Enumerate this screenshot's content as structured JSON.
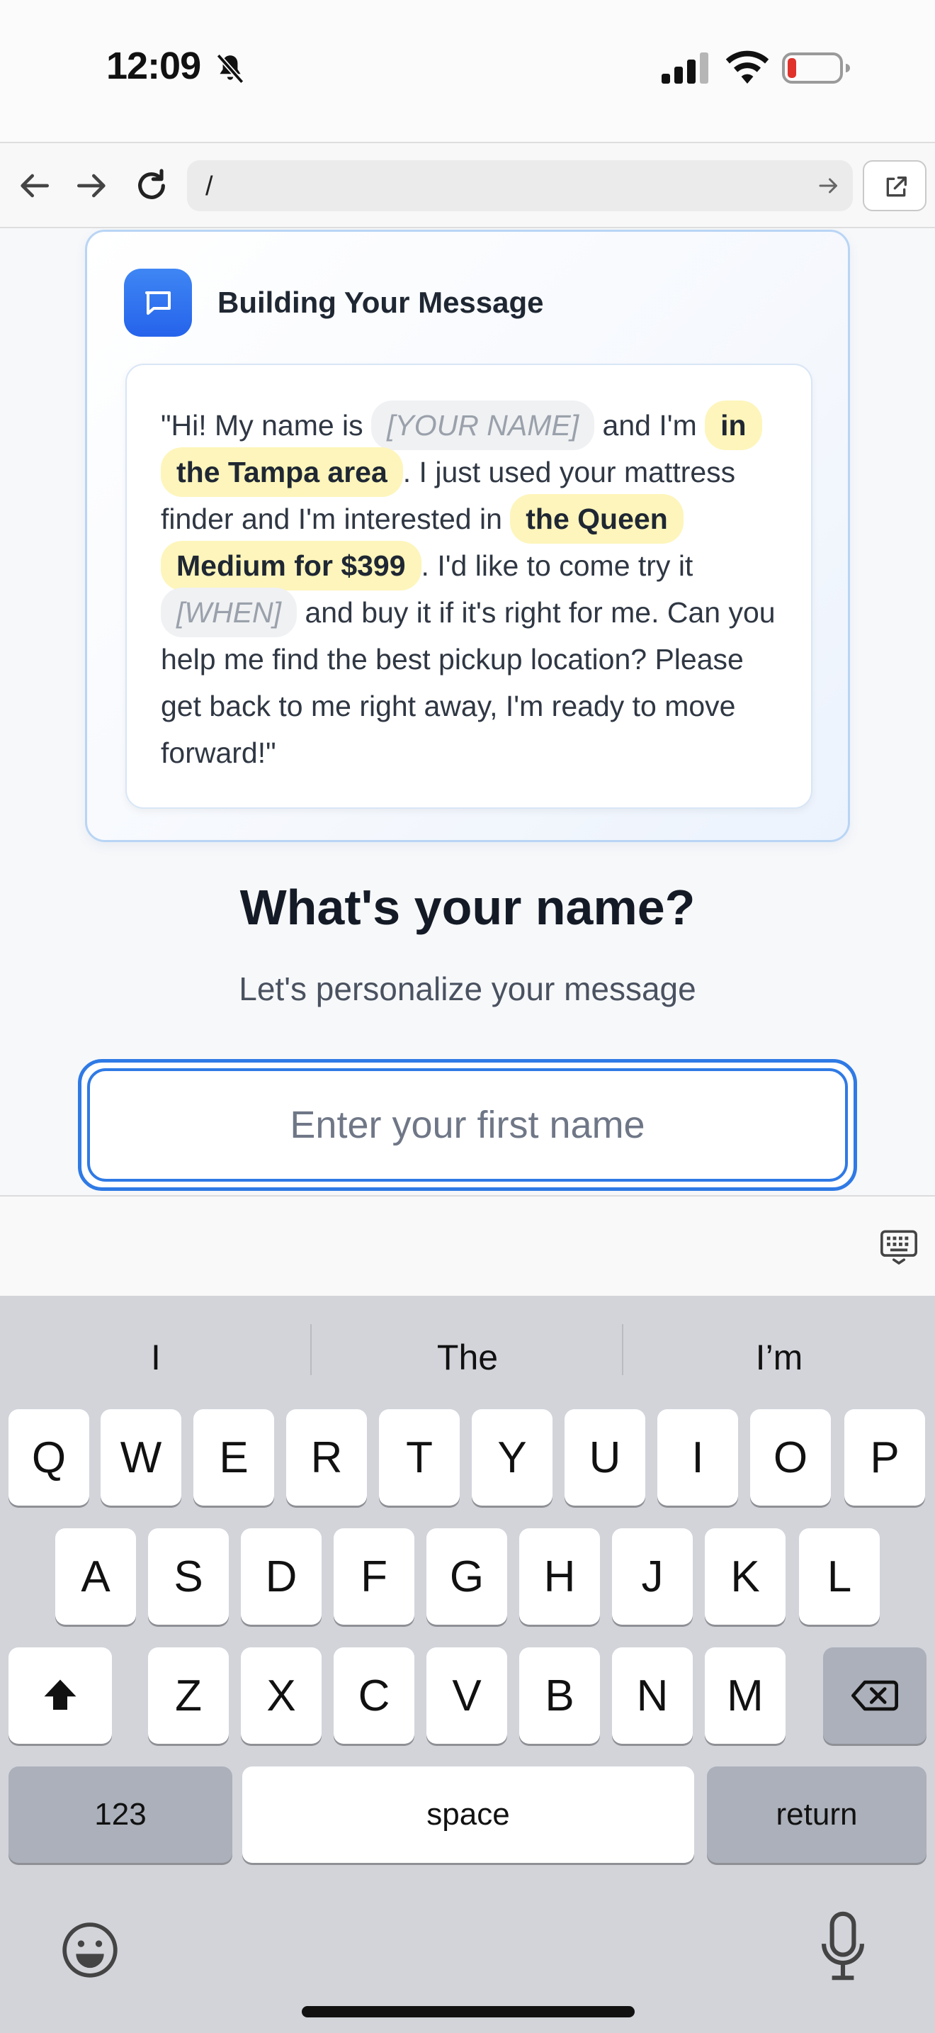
{
  "status_bar": {
    "time": "12:09",
    "icons": [
      "bell-slash-icon",
      "signal-icon",
      "wifi-icon",
      "battery-low-icon"
    ]
  },
  "browser": {
    "url": "/",
    "icons": [
      "back-arrow-icon",
      "forward-arrow-icon",
      "reload-icon",
      "go-arrow-icon",
      "open-external-icon"
    ]
  },
  "message_card": {
    "title": "Building Your Message",
    "icon": "chat-bubble-icon",
    "text": {
      "p1": "\"Hi! My name is ",
      "name_placeholder": "[YOUR NAME]",
      "p2": " and I'm ",
      "area": "in the Tampa area",
      "p3": ". I just used your mattress finder and I'm interested in ",
      "product": "the Queen Medium for $399",
      "p4": ". I'd like to come try it ",
      "when_placeholder": "[WHEN]",
      "p5": " and buy it if it's right for me. Can you help me find the best pickup location? Please get back to me right away, I'm ready to move forward!\""
    }
  },
  "question": {
    "title": "What's your name?",
    "subtitle": "Let's personalize your message",
    "input_placeholder": "Enter your first name"
  },
  "keyboard": {
    "suggestions": [
      "I",
      "The",
      "I’m"
    ],
    "row1": [
      "Q",
      "W",
      "E",
      "R",
      "T",
      "Y",
      "U",
      "I",
      "O",
      "P"
    ],
    "row2": [
      "A",
      "S",
      "D",
      "F",
      "G",
      "H",
      "J",
      "K",
      "L"
    ],
    "row3": [
      "Z",
      "X",
      "C",
      "V",
      "B",
      "N",
      "M"
    ],
    "numbers_label": "123",
    "space_label": "space",
    "return_label": "return",
    "icons": [
      "shift-icon",
      "backspace-icon",
      "emoji-icon",
      "microphone-icon",
      "keyboard-dismiss-icon"
    ]
  },
  "colors": {
    "accent": "#2f7ae5",
    "highlight": "#fdf5bb",
    "placeholder_chip": "#f0f1f3",
    "keyboard_bg": "#d2d4da"
  }
}
